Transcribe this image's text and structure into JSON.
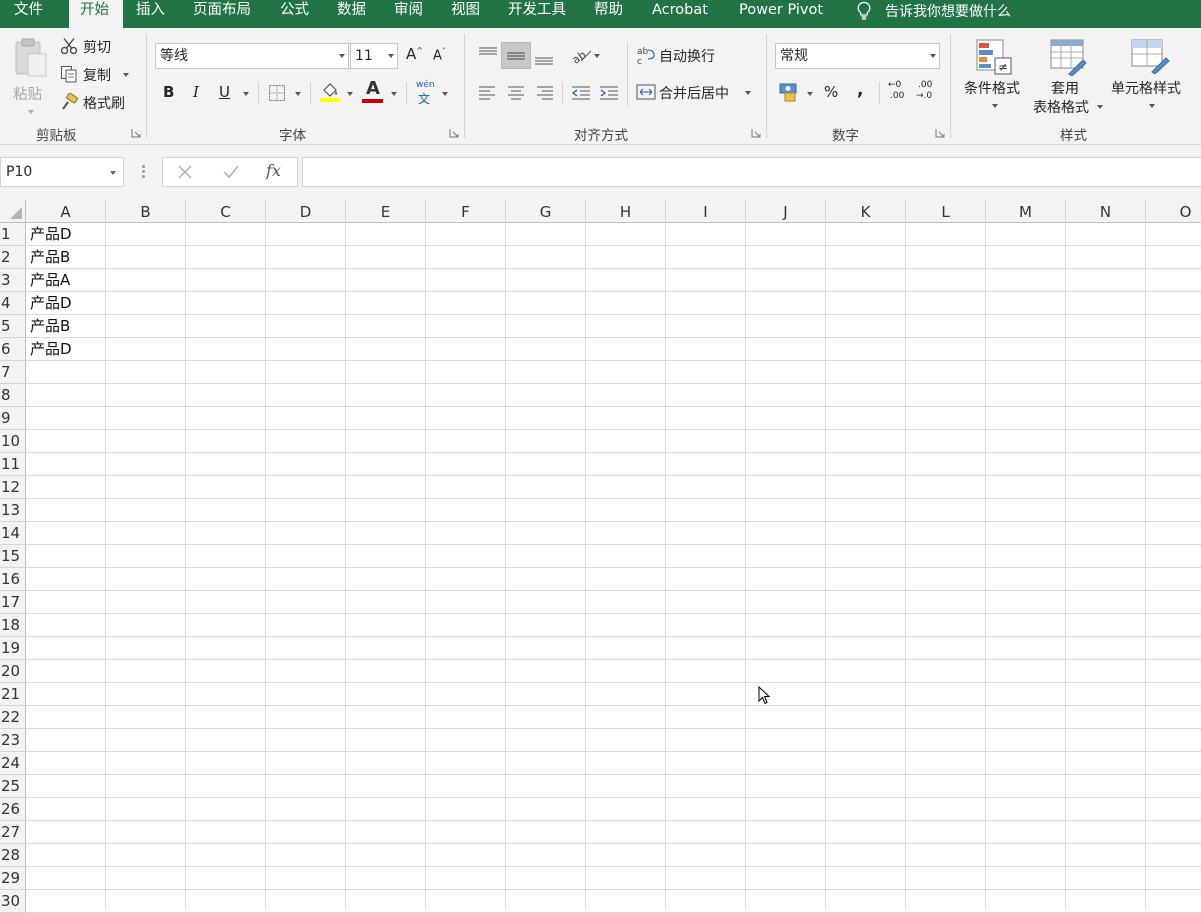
{
  "tabs": [
    {
      "label": "文件"
    },
    {
      "label": "开始",
      "active": true
    },
    {
      "label": "插入"
    },
    {
      "label": "页面布局"
    },
    {
      "label": "公式"
    },
    {
      "label": "数据"
    },
    {
      "label": "审阅"
    },
    {
      "label": "视图"
    },
    {
      "label": "开发工具"
    },
    {
      "label": "帮助"
    },
    {
      "label": "Acrobat"
    },
    {
      "label": "Power Pivot"
    }
  ],
  "tell_me": {
    "label": "告诉我你想要做什么",
    "icon": "lightbulb-icon"
  },
  "ribbon": {
    "clipboard": {
      "group_label": "剪贴板",
      "paste": "粘贴",
      "cut": "剪切",
      "copy": "复制",
      "format_painter": "格式刷"
    },
    "font": {
      "group_label": "字体",
      "font_name": "等线",
      "font_size": "11",
      "grow": "A",
      "shrink": "A",
      "bold": "B",
      "italic": "I",
      "underline": "U",
      "font_color_glyph": "A",
      "phonetic_top": "wén",
      "phonetic_bottom": "文",
      "fill_color": "#ffff00",
      "font_color": "#c00000"
    },
    "alignment": {
      "group_label": "对齐方式",
      "wrap_text": "自动换行",
      "merge_center": "合并后居中"
    },
    "number": {
      "group_label": "数字",
      "format": "常规",
      "percent": "%",
      "comma": ",",
      "inc_decimal_top": "←0",
      "inc_decimal_bottom": ".00",
      "dec_decimal_top": ".00",
      "dec_decimal_bottom": "→.0"
    },
    "styles": {
      "group_label": "样式",
      "conditional": "条件格式",
      "table_format_1": "套用",
      "table_format_2": "表格格式",
      "cell_styles": "单元格样式"
    }
  },
  "formula_bar": {
    "name_box": "P10",
    "fx": "fx",
    "formula": ""
  },
  "sheet": {
    "columns": [
      "A",
      "B",
      "C",
      "D",
      "E",
      "F",
      "G",
      "H",
      "I",
      "J",
      "K",
      "L",
      "M",
      "N",
      "O"
    ],
    "rows": [
      "1",
      "2",
      "3",
      "4",
      "5",
      "6",
      "7",
      "8",
      "9",
      "10",
      "11",
      "12",
      "13",
      "14",
      "15",
      "16",
      "17",
      "18",
      "19",
      "20",
      "21",
      "22",
      "23",
      "24",
      "25",
      "26",
      "27",
      "28",
      "29",
      "30"
    ],
    "cells_A": [
      "产品D",
      "产品B",
      "产品A",
      "产品D",
      "产品B",
      "产品D"
    ]
  },
  "colors": {
    "accent": "#217346",
    "ribbon_bg": "#f3f3f3",
    "gridline": "#dadada"
  }
}
